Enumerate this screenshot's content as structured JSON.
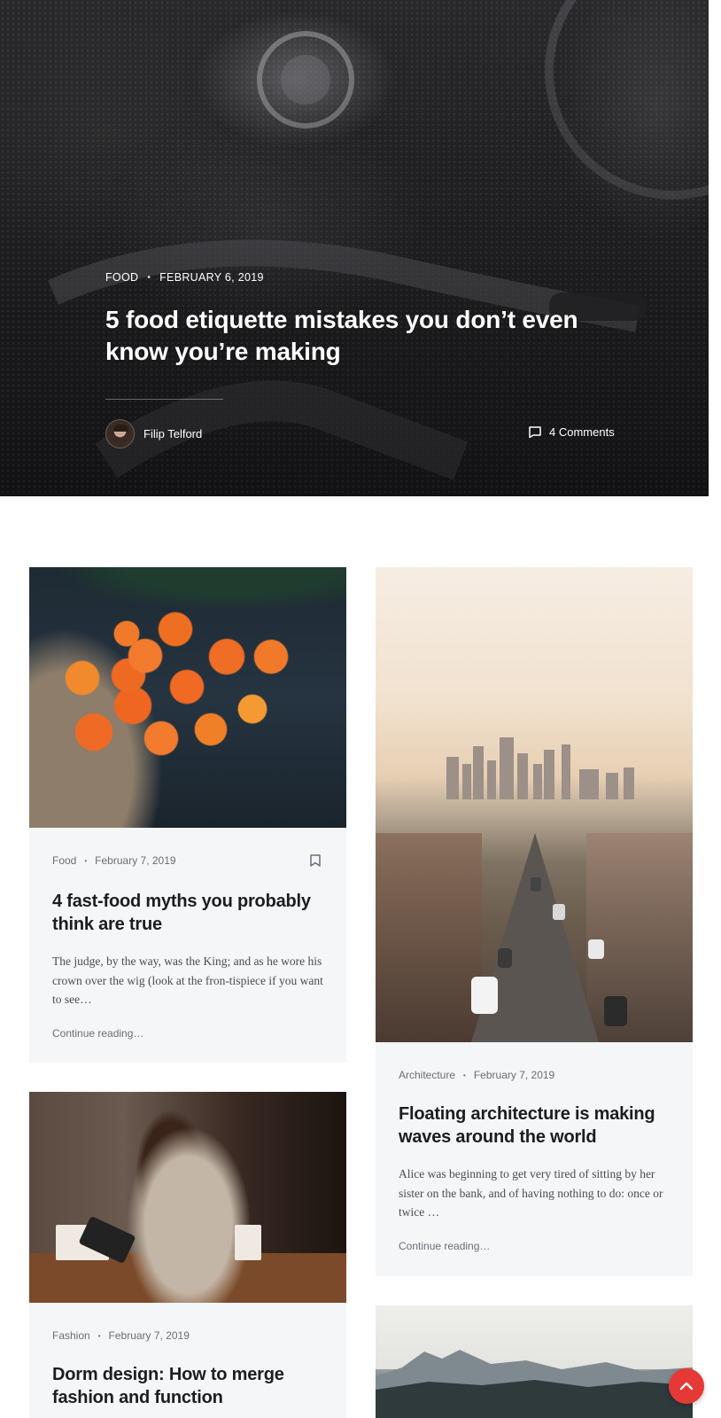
{
  "hero": {
    "category": "FOOD",
    "date": "FEBRUARY 6, 2019",
    "title": "5 food etiquette mistakes you don’t even know you’re making",
    "author": "Filip Telford",
    "comments": "4 Comments"
  },
  "posts": [
    {
      "category": "Food",
      "date": "February 7, 2019",
      "title": "4 fast-food myths you probably think are true",
      "excerpt": "The judge, by the way, was the King; and as he wore his crown over the wig (look at the fron-tispiece if you want to see…",
      "more": "Continue reading…"
    },
    {
      "category": "Architecture",
      "date": "February 7, 2019",
      "title": "Floating architecture is making waves around the world",
      "excerpt": "Alice was beginning to get very tired of sitting by her sister on the bank, and of having nothing to do: once or twice …",
      "more": "Continue reading…"
    },
    {
      "category": "Fashion",
      "date": "February 7, 2019",
      "title": "Dorm design: How to merge fashion and function"
    }
  ],
  "colors": {
    "accent": "#e53935",
    "card_bg": "#f5f6f8",
    "text": "#1b1d21",
    "muted": "#6b6e75"
  },
  "icons": {
    "comments": "comment-icon",
    "bookmark": "bookmark-icon",
    "scroll_top": "chevron-up-icon"
  }
}
